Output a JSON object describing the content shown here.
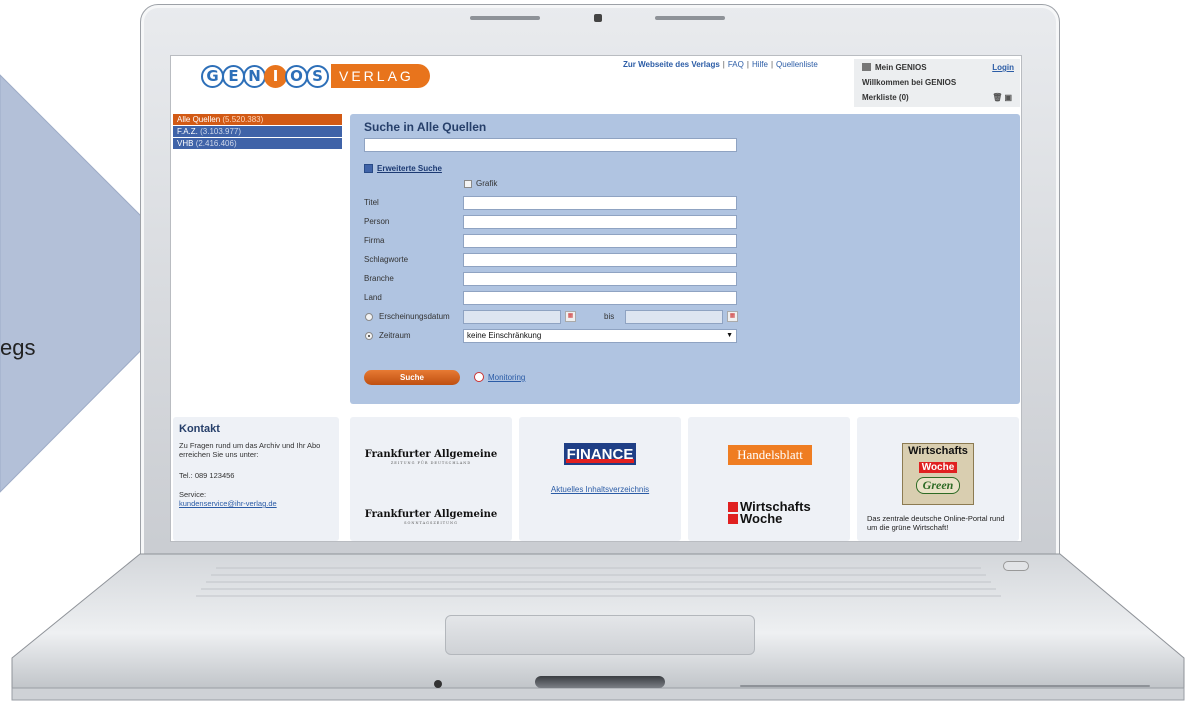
{
  "slide": {
    "partial_text": "egs",
    "arrow_color": "#b3c0d8"
  },
  "header": {
    "logo_letters": [
      "G",
      "E",
      "N",
      "I",
      "O",
      "S"
    ],
    "logo_verlag": "VERLAG",
    "links": {
      "verlag": "Zur Webseite des Verlags",
      "faq": "FAQ",
      "hilfe": "Hilfe",
      "quellenliste": "Quellenliste",
      "separator": "|"
    }
  },
  "mygenios": {
    "title": "Mein GENIOS",
    "login": "Login",
    "welcome": "Willkommen bei GENIOS",
    "merkliste": "Merkliste (0)",
    "tool_icons": "🗑▣"
  },
  "sources": [
    {
      "name": "Alle Quellen",
      "count": "(5.520.383)",
      "active": true
    },
    {
      "name": "F.A.Z.",
      "count": "(3.103.977)",
      "active": false
    },
    {
      "name": "VHB",
      "count": "(2.416.406)",
      "active": false
    }
  ],
  "search": {
    "title": "Suche in Alle Quellen",
    "query_value": "",
    "advanced_label": "Erweiterte Suche",
    "grafik_label": "Grafik",
    "fields": [
      {
        "label": "Titel",
        "value": ""
      },
      {
        "label": "Person",
        "value": ""
      },
      {
        "label": "Firma",
        "value": ""
      },
      {
        "label": "Schlagworte",
        "value": ""
      },
      {
        "label": "Branche",
        "value": ""
      },
      {
        "label": "Land",
        "value": ""
      }
    ],
    "date_label": "Erscheinungsdatum",
    "date_from": "",
    "date_bis_label": "bis",
    "date_to": "",
    "zeitraum_label": "Zeitraum",
    "zeitraum_value": "keine Einschränkung",
    "zeitraum_selected": true,
    "submit_label": "Suche",
    "monitoring_label": "Monitoring"
  },
  "kontakt": {
    "title": "Kontakt",
    "intro": "Zu Fragen rund um das Archiv und Ihr Abo erreichen Sie uns unter:",
    "tel": "Tel.: 089 123456",
    "service_label": "Service:",
    "email": "kundenservice@ihr-verlag.de"
  },
  "publications": {
    "faz": "Frankfurter Allgemeine",
    "faz_sub": "ZEITUNG FÜR DEUTSCHLAND",
    "fas": "Frankfurter Allgemeine",
    "fas_sub": "SONNTAGSZEITUNG",
    "finance": "FINANCE",
    "finance_link": "Aktuelles Inhaltsverzeichnis",
    "handelsblatt": "Handelsblatt",
    "wiwo_line1": "Wirtschafts",
    "wiwo_line2": "Woche",
    "wwg_line1": "Wirtschafts",
    "wwg_line2": "Woche",
    "wwg_line3": "Green",
    "wwg_text": "Das zentrale deutsche Online-Portal rund um die grüne Wirtschaft!"
  }
}
